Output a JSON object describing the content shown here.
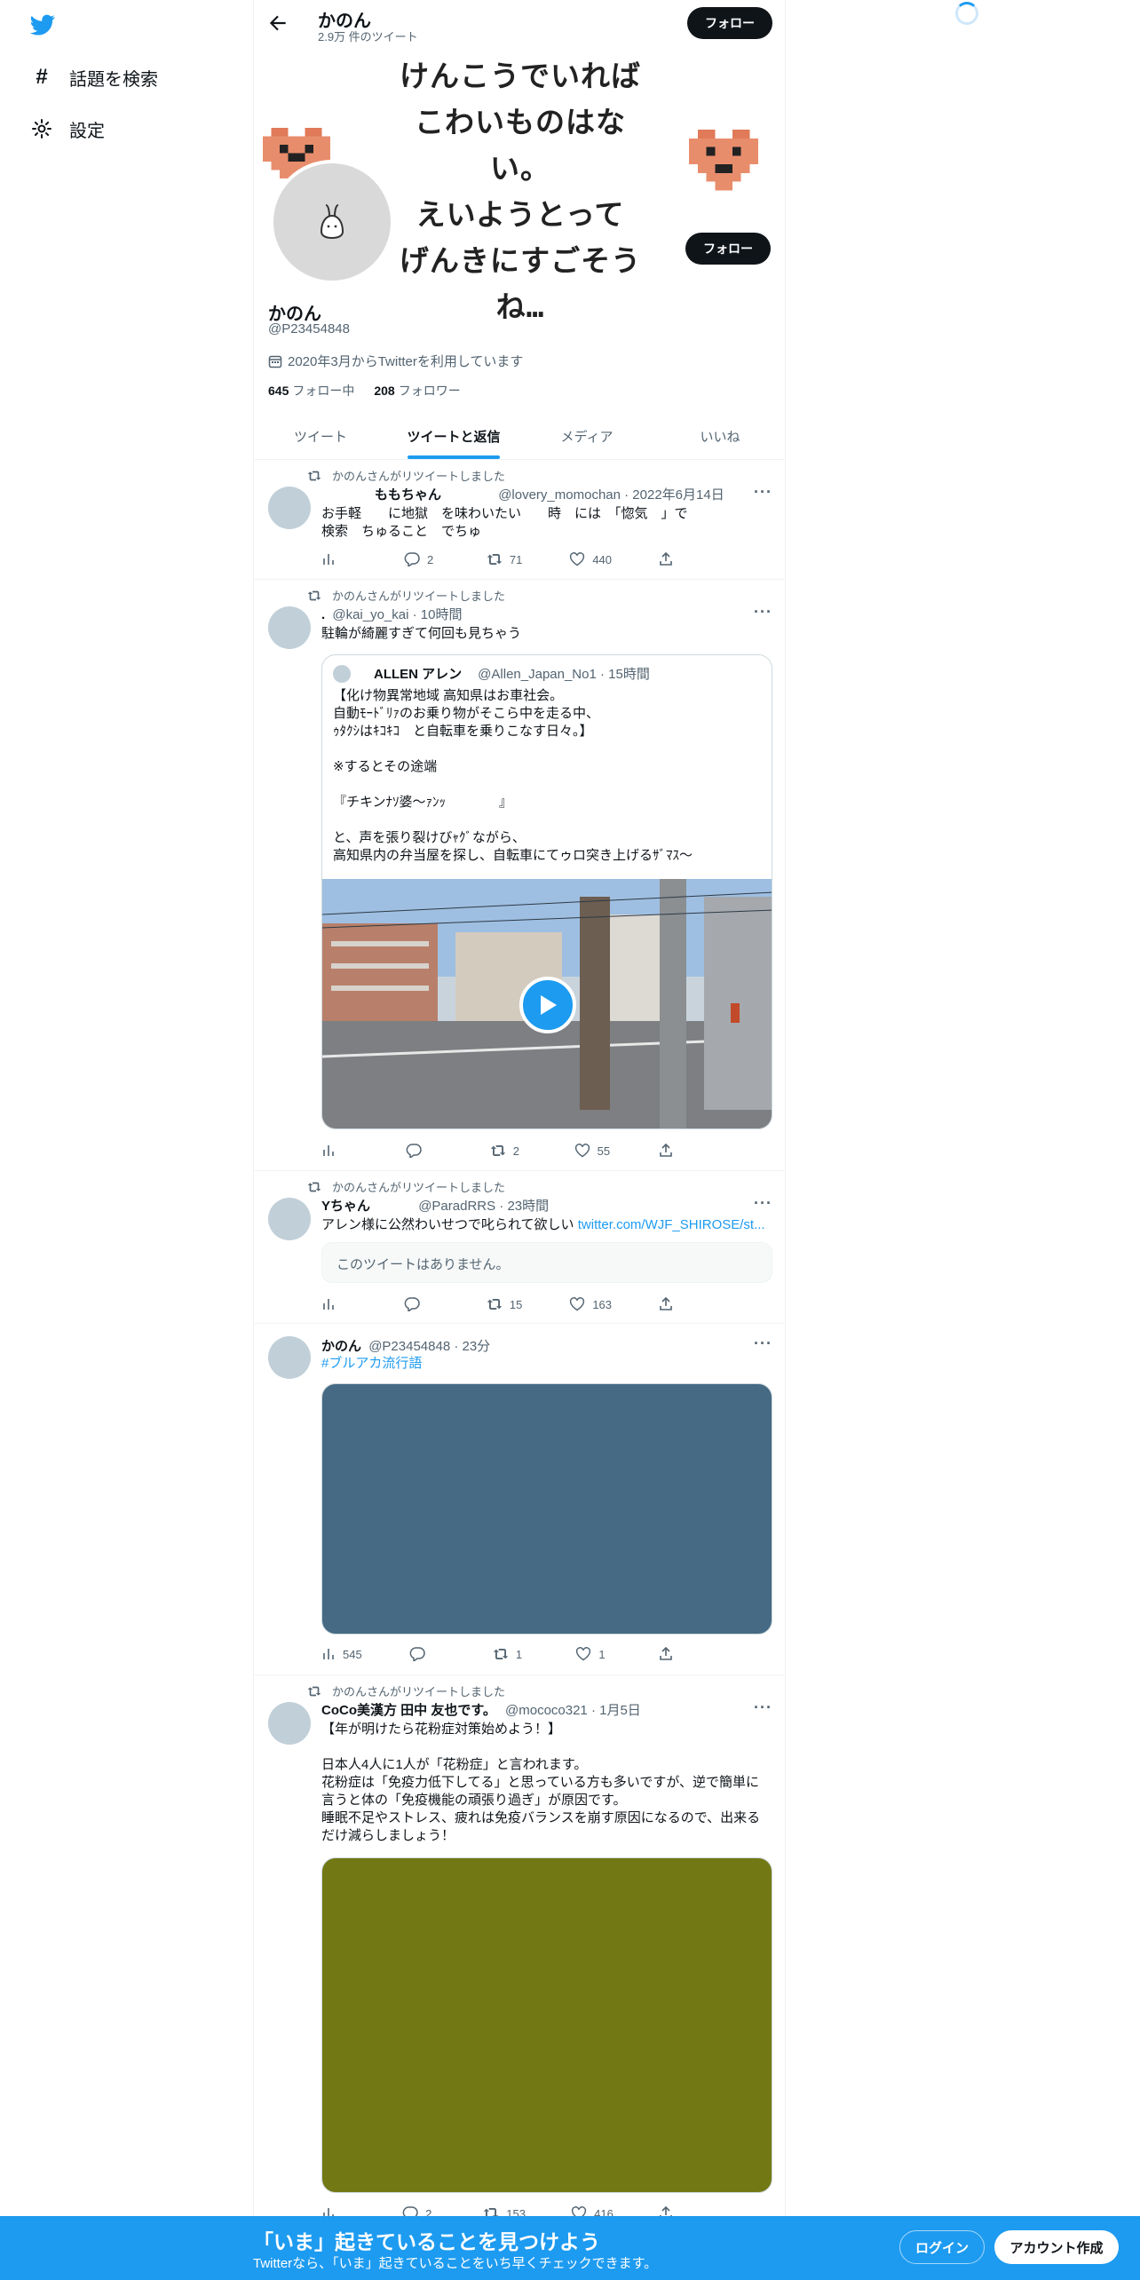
{
  "nav": {
    "explore_label": "話題を検索",
    "settings_label": "設定"
  },
  "header": {
    "title": "かのん",
    "subtitle": "2.9万 件のツイート",
    "follow_label": "フォロー"
  },
  "banner": {
    "lines": [
      "けんこうでいれば",
      "こわいものはない。",
      "えいようとって",
      "げんきにすごそうね…"
    ]
  },
  "profile": {
    "name": "かのん",
    "handle": "@P23454848",
    "joined": "2020年3月からTwitterを利用しています",
    "following_count": "645",
    "following_label": "フォロー中",
    "followers_count": "208",
    "followers_label": "フォロワー",
    "follow_label": "フォロー"
  },
  "tabs": [
    {
      "label": "ツイート",
      "active": false
    },
    {
      "label": "ツイートと返信",
      "active": true
    },
    {
      "label": "メディア",
      "active": false
    },
    {
      "label": "いいね",
      "active": false
    }
  ],
  "tweets": [
    {
      "retweet_label": "かのんさんがリツイートしました",
      "name": "ももちゃん",
      "handle_time": "@lovery_momochan · 2022年6月14日",
      "text": "お手軽　　に地獄　を味わいたい　　時　には　「惚気　」で\n検索　ちゅること　でちゅ",
      "replies": "2",
      "retweets": "71",
      "likes": "440",
      "views": ""
    },
    {
      "retweet_label": "かのんさんがリツイートしました",
      "name": ".",
      "handle_time": "@kai_yo_kai · 10時間",
      "text": "駐輪が綺麗すぎて何回も見ちゃう",
      "quote": {
        "name": "ALLEN アレン",
        "handle_time": "@Allen_Japan_No1 · 15時間",
        "text": "【化け物異常地域 高知県はお車社会。\n自動ﾓｰﾄﾞﾘｧのお乗り物がそこら中を走る中、\nｩﾀｸｼはｷｺｷｺ　と自転車を乗りこなす日々。】\n\n※するとその途端\n\n『チキンﾅｿ婆〜ｧﾝｯ　　　　』\n\nと、声を張り裂けびｬｸﾞながら、\n高知県内の弁当屋を探し、自転車にてゥロ突き上げるｻﾞﾏｽ〜"
      },
      "replies": "",
      "retweets": "2",
      "likes": "55",
      "views": ""
    },
    {
      "retweet_label": "かのんさんがリツイートしました",
      "name": "Yちゃん",
      "handle_time": "@ParadRRS · 23時間",
      "text": "アレン様に公然わいせつで叱られて欲しい",
      "link": "twitter.com/WJF_SHIROSE/st...",
      "unavailable": "このツイートはありません。",
      "replies": "",
      "retweets": "15",
      "likes": "163",
      "views": ""
    },
    {
      "name": "かのん",
      "handle_time": "@P23454848 · 23分",
      "hashtag": "#ブルアカ流行語",
      "media_color": "#466a84",
      "replies": "",
      "retweets": "1",
      "likes": "1",
      "views": "545"
    },
    {
      "retweet_label": "かのんさんがリツイートしました",
      "name": "CoCo美漢方 田中 友也です。",
      "handle_time": "@mococo321 · 1月5日",
      "text": "【年が明けたら花粉症対策始めよう！】\n\n日本人4人に1人が「花粉症」と言われます。\n花粉症は「免疫力低下してる」と思っている方も多いですが、逆で簡単に\n言うと体の「免疫機能の頑張り過ぎ」が原因です。\n睡眠不足やストレス、疲れは免疫バランスを崩す原因になるので、出来る\nだけ減らしましょう！",
      "media_color": "#727814",
      "replies": "2",
      "retweets": "153",
      "likes": "416",
      "views": ""
    }
  ],
  "bottom_bar": {
    "title": "「いま」起きていることを見つけよう",
    "subtitle": "Twitterなら、「いま」起きていることをいち早くチェックできます。",
    "login_label": "ログイン",
    "signup_label": "アカウント作成"
  }
}
